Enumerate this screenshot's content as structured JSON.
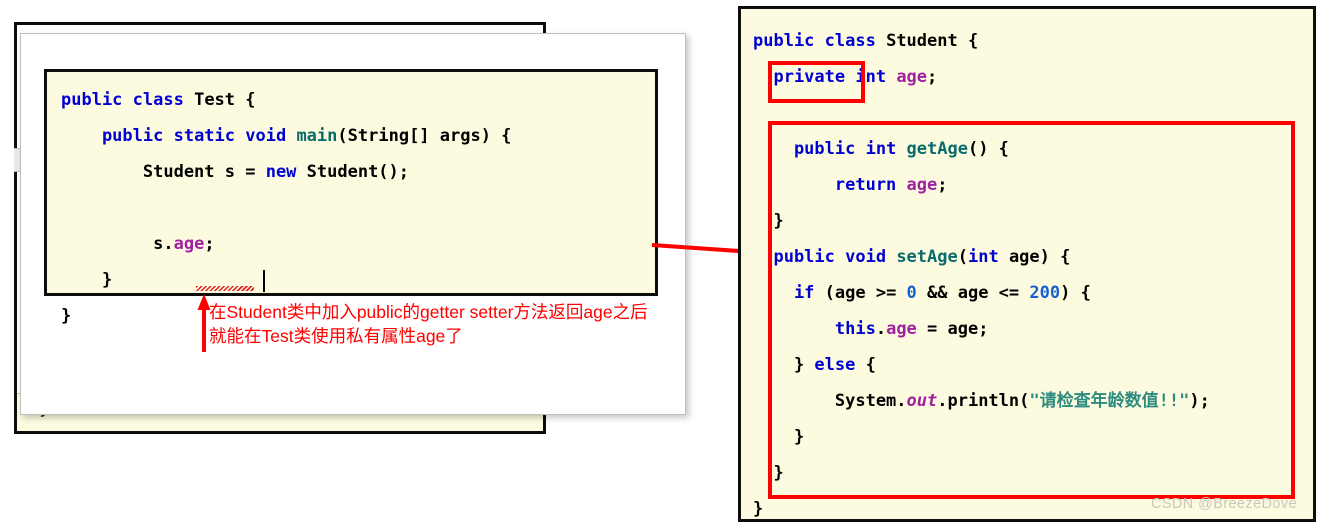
{
  "left_panel": {
    "background_window_tail": "}",
    "editor": {
      "lines": [
        {
          "tokens": [
            {
              "t": "public ",
              "c": "kw"
            },
            {
              "t": "class ",
              "c": "kw"
            },
            {
              "t": "Test",
              "c": "plain"
            },
            {
              "t": " {",
              "c": "plain"
            }
          ]
        },
        {
          "tokens": [
            {
              "t": "    public ",
              "c": "kw"
            },
            {
              "t": "static ",
              "c": "kw"
            },
            {
              "t": "void ",
              "c": "kw"
            },
            {
              "t": "main",
              "c": "mth"
            },
            {
              "t": "(",
              "c": "plain"
            },
            {
              "t": "String",
              "c": "plain"
            },
            {
              "t": "[] args) {",
              "c": "plain"
            }
          ]
        },
        {
          "tokens": [
            {
              "t": "        Student s = ",
              "c": "plain"
            },
            {
              "t": "new ",
              "c": "kw"
            },
            {
              "t": "Student();",
              "c": "plain"
            }
          ]
        },
        {
          "tokens": []
        },
        {
          "tokens": [
            {
              "t": "         ",
              "c": "plain"
            },
            {
              "t": "s.",
              "c": "plain"
            },
            {
              "t": "age",
              "c": "fld"
            },
            {
              "t": ";",
              "c": "plain"
            }
          ]
        },
        {
          "tokens": [
            {
              "t": "    }",
              "c": "plain"
            }
          ]
        },
        {
          "tokens": [
            {
              "t": "}",
              "c": "plain"
            }
          ]
        }
      ]
    },
    "annotation": {
      "line1": "在Student类中加入public的getter setter方法返回age之后",
      "line2": "就能在Test类使用私有属性age了",
      "color": "#ff0000"
    }
  },
  "right_panel": {
    "lines": [
      {
        "tokens": [
          {
            "t": "public ",
            "c": "kw"
          },
          {
            "t": "class ",
            "c": "kw"
          },
          {
            "t": "Student",
            "c": "plain"
          },
          {
            "t": " {",
            "c": "plain"
          }
        ]
      },
      {
        "tokens": [
          {
            "t": "  private ",
            "c": "kw"
          },
          {
            "t": "int ",
            "c": "kw"
          },
          {
            "t": "age",
            "c": "fld"
          },
          {
            "t": ";",
            "c": "plain"
          }
        ]
      },
      {
        "tokens": []
      },
      {
        "tokens": [
          {
            "t": "    public ",
            "c": "kw"
          },
          {
            "t": "int ",
            "c": "kw"
          },
          {
            "t": "getAge",
            "c": "mth"
          },
          {
            "t": "() {",
            "c": "plain"
          }
        ]
      },
      {
        "tokens": [
          {
            "t": "        return ",
            "c": "kw"
          },
          {
            "t": "age",
            "c": "fld"
          },
          {
            "t": ";",
            "c": "plain"
          }
        ]
      },
      {
        "tokens": [
          {
            "t": "  }",
            "c": "plain"
          }
        ]
      },
      {
        "tokens": [
          {
            "t": "  public ",
            "c": "kw"
          },
          {
            "t": "void ",
            "c": "kw"
          },
          {
            "t": "setAge",
            "c": "mth"
          },
          {
            "t": "(",
            "c": "plain"
          },
          {
            "t": "int ",
            "c": "kw"
          },
          {
            "t": "age",
            "c": "plain"
          },
          {
            "t": ") {",
            "c": "plain"
          }
        ]
      },
      {
        "tokens": [
          {
            "t": "    if ",
            "c": "kw"
          },
          {
            "t": "(age >= ",
            "c": "plain"
          },
          {
            "t": "0",
            "c": "num"
          },
          {
            "t": " && age <= ",
            "c": "plain"
          },
          {
            "t": "200",
            "c": "num"
          },
          {
            "t": ") {",
            "c": "plain"
          }
        ]
      },
      {
        "tokens": [
          {
            "t": "        this",
            "c": "kw"
          },
          {
            "t": ".",
            "c": "plain"
          },
          {
            "t": "age",
            "c": "fld"
          },
          {
            "t": " = age;",
            "c": "plain"
          }
        ]
      },
      {
        "tokens": [
          {
            "t": "    } ",
            "c": "plain"
          },
          {
            "t": "else ",
            "c": "kw"
          },
          {
            "t": "{",
            "c": "plain"
          }
        ]
      },
      {
        "tokens": [
          {
            "t": "        System.",
            "c": "plain"
          },
          {
            "t": "out",
            "c": "fldi"
          },
          {
            "t": ".println(",
            "c": "plain"
          },
          {
            "t": "\"请检查年龄数值!!\"",
            "c": "str"
          },
          {
            "t": ");",
            "c": "plain"
          }
        ]
      },
      {
        "tokens": [
          {
            "t": "    }",
            "c": "plain"
          }
        ]
      },
      {
        "tokens": [
          {
            "t": "  }",
            "c": "plain"
          }
        ]
      },
      {
        "tokens": [
          {
            "t": "}",
            "c": "plain"
          }
        ]
      }
    ],
    "highlight_boxes": [
      {
        "name": "private-keyword-box",
        "label": "private"
      },
      {
        "name": "getter-setter-methods-box",
        "label": "getAge / setAge methods"
      }
    ]
  },
  "watermark": "CSDN @BreezeDove",
  "colors": {
    "editor_background": "#fcfbe0",
    "window_background": "#ffffff",
    "border": "#0d0d0d",
    "annotation_red": "#ff0000",
    "keyword_blue": "#0000d0",
    "field_purple": "#a020a0",
    "method_teal": "#0a6b6b",
    "number_blue": "#1a5fd0",
    "string_green": "#2e8b7f",
    "watermark_gray": "#c8c8bc"
  }
}
